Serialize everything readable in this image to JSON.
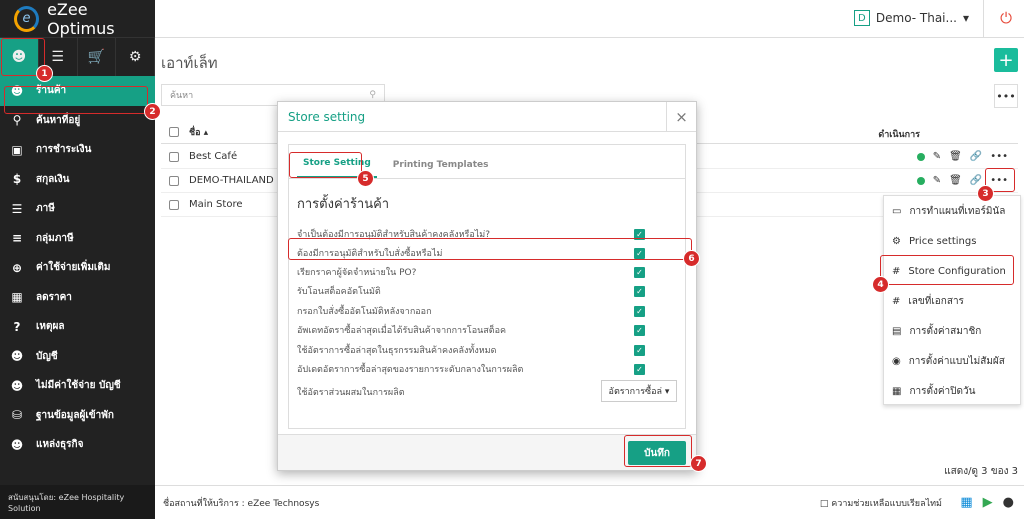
{
  "brand": {
    "name": "eZee Optimus",
    "logo_letter": "e"
  },
  "sidebar": {
    "top_icons": [
      "user-icon",
      "menu-icon",
      "cart-icon",
      "gear-icon"
    ],
    "items": [
      {
        "label": "ร้านค้า",
        "icon": "user-icon"
      },
      {
        "label": "ค้นหาที่อยู่",
        "icon": "pin-icon"
      },
      {
        "label": "การชำระเงิน",
        "icon": "card-icon"
      },
      {
        "label": "สกุลเงิน",
        "icon": "dollar-icon"
      },
      {
        "label": "ภาษี",
        "icon": "list-icon"
      },
      {
        "label": "กลุ่มภาษี",
        "icon": "list-icon"
      },
      {
        "label": "ค่าใช้จ่ายเพิ่มเติม",
        "icon": "plus-icon"
      },
      {
        "label": "ลดราคา",
        "icon": "gift-icon"
      },
      {
        "label": "เหตุผล",
        "icon": "question-icon"
      },
      {
        "label": "บัญชี",
        "icon": "user-icon"
      },
      {
        "label": "ไม่มีค่าใช้จ่าย บัญชี",
        "icon": "user-icon"
      },
      {
        "label": "ฐานข้อมูลผู้เข้าพัก",
        "icon": "database-icon"
      },
      {
        "label": "แหล่งธุรกิจ",
        "icon": "users-icon"
      }
    ],
    "powered_by": "สนับสนุนโดย: eZee Hospitality Solution"
  },
  "header": {
    "property_letter": "D",
    "property_name": "Demo- Thai...",
    "caret": "▾",
    "power_icon": "power-icon"
  },
  "main": {
    "title": "เอาท์เล็ท",
    "search_placeholder": "ค้นหา",
    "add_label": "+",
    "more_label": "•••",
    "columns": {
      "name": "ชื่อ ▴",
      "actions": "ดำเนินการ"
    },
    "rows": [
      {
        "name": "Best Café"
      },
      {
        "name": "DEMO-THAILAND"
      },
      {
        "name": "Main Store"
      }
    ],
    "row_more": "•••",
    "paging": "แสดง/ดู 3 ของ 3"
  },
  "dropdown": [
    {
      "label": "การทำแผนที่เทอร์มินัล",
      "icon": "monitor-icon"
    },
    {
      "label": "Price settings",
      "icon": "gear-icon"
    },
    {
      "label": "Store Configuration",
      "icon": "hash-icon"
    },
    {
      "label": "เลขที่เอกสาร",
      "icon": "hash-icon"
    },
    {
      "label": "การตั้งค่าสมาชิก",
      "icon": "id-card-icon"
    },
    {
      "label": "การตั้งค่าแบบไม่สัมผัส",
      "icon": "eye-icon"
    },
    {
      "label": "การตั้งค่าปิดวัน",
      "icon": "calendar-icon"
    }
  ],
  "footer": {
    "service": "ชื่อสถานที่ให้บริการ : eZee Technosys",
    "help": "ความช่วยเหลือแบบเรียลไทม์",
    "os_icons": [
      "windows-icon",
      "play-store-icon",
      "apple-icon"
    ]
  },
  "modal": {
    "title": "Store setting",
    "close": "×",
    "tabs": [
      "Store Setting",
      "Printing Templates"
    ],
    "section": "การตั้งค่าร้านค้า",
    "options": [
      "จำเป็นต้องมีการอนุมัติสำหรับสินค้าคงคลังหรือไม่?",
      "ต้องมีการอนุมัติสำหรับใบสั่งซื้อหรือไม่",
      "เรียกราคาผู้จัดจำหน่ายใน PO?",
      "รับโอนสต็อคอัตโนมัติ",
      "กรอกใบสั่งซื้ออัตโนมัติหลังจากออก",
      "อัพเดทอัตราซื้อล่าสุดเมื่อได้รับสินค้าจากการโอนสต็อค",
      "ใช้อัตราการซื้อล่าสุดในธุรกรรมสินค้าคงคลังทั้งหมด",
      "อัปเดตอัตราการซื้อล่าสุดของรายการระดับกลางในการผลิต"
    ],
    "check": "✓",
    "ratio_label": "ใช้อัตราส่วนผสมในการผลิต",
    "ratio_value": "อัตราการซื้อล่ ▾",
    "save": "บันทึก"
  },
  "annotations": [
    "1",
    "2",
    "3",
    "4",
    "5",
    "6",
    "7"
  ],
  "colors": {
    "accent": "#16a085",
    "highlight": "#d62b2b",
    "sidebar": "#222222"
  }
}
